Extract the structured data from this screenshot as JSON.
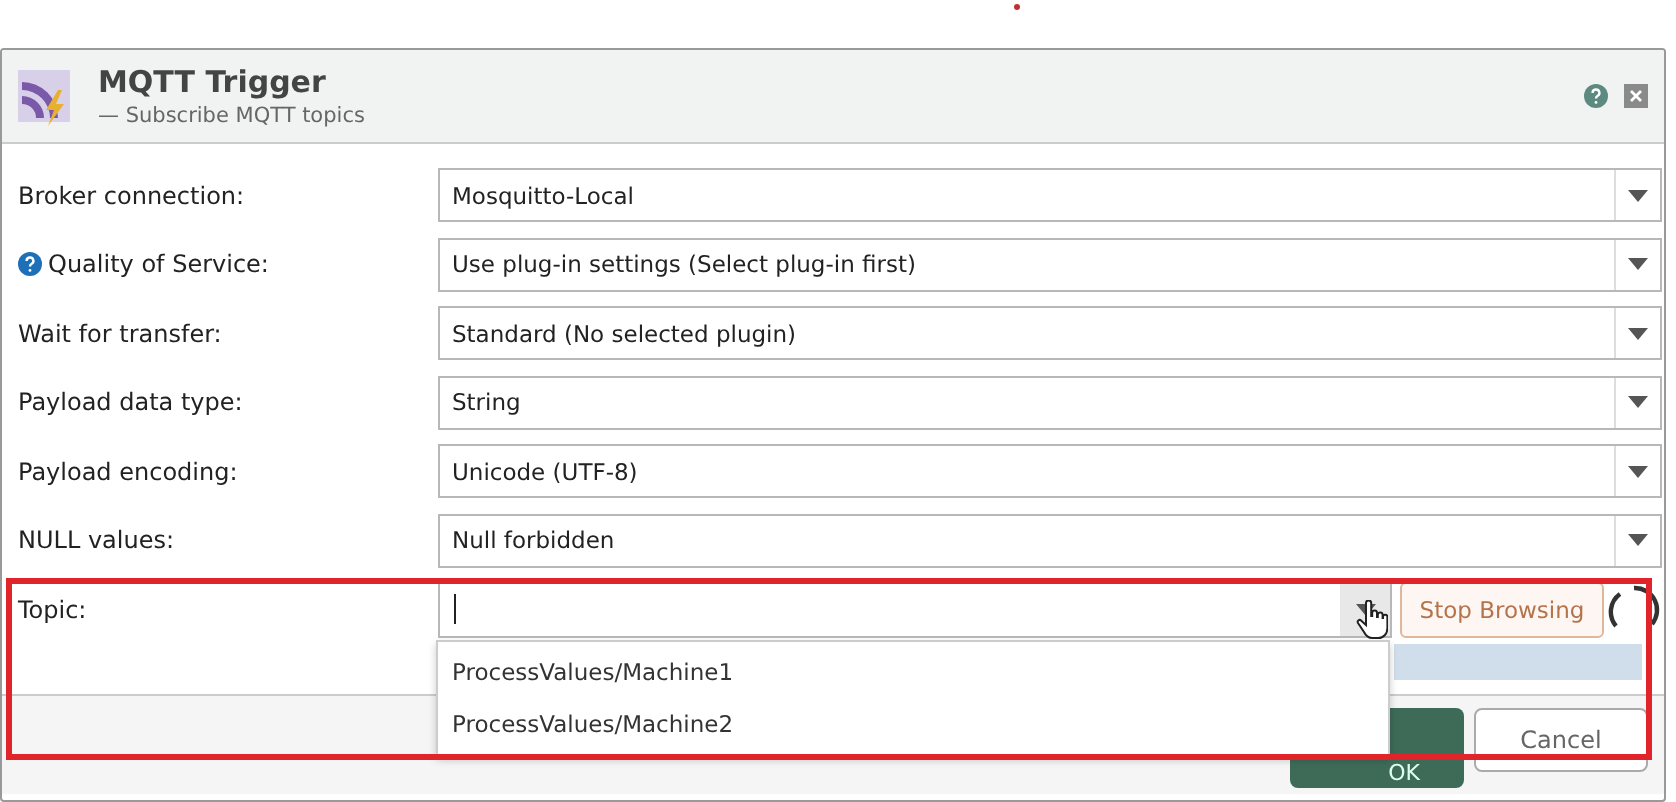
{
  "window": {
    "title": "MQTT Trigger",
    "subtitle": "— Subscribe MQTT topics"
  },
  "fields": [
    {
      "label": "Broker connection:",
      "value": "Mosquitto-Local",
      "help": false
    },
    {
      "label": "Quality of Service:",
      "value": "Use plug-in settings (Select plug-in first)",
      "help": true
    },
    {
      "label": "Wait for transfer:",
      "value": "Standard (No selected plugin)",
      "help": false
    },
    {
      "label": "Payload data type:",
      "value": "String",
      "help": false
    },
    {
      "label": "Payload encoding:",
      "value": "Unicode (UTF-8)",
      "help": false
    },
    {
      "label": "NULL values:",
      "value": "Null forbidden",
      "help": false
    }
  ],
  "topic": {
    "label": "Topic:",
    "browse_button": "Stop Browsing",
    "loading": true,
    "options": [
      {
        "label": "ProcessValues/Machine1",
        "selected": false
      },
      {
        "label": "ProcessValues/Machine2",
        "selected": false
      }
    ]
  },
  "buttons": [
    {
      "label": "OK",
      "kind": "primary"
    },
    {
      "label": "Cancel",
      "kind": "secondary"
    }
  ]
}
